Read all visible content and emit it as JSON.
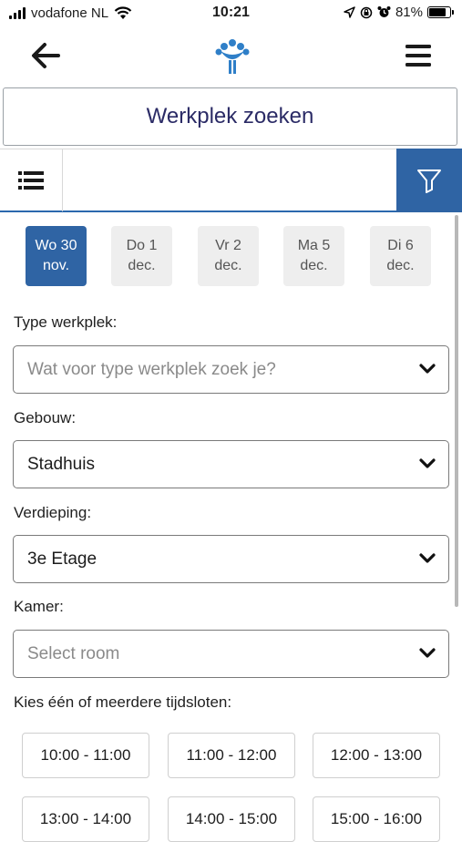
{
  "status_bar": {
    "carrier": "vodafone NL",
    "time": "10:21",
    "battery": "81%",
    "battery_level": 0.81,
    "icons": [
      "signal-icon",
      "wifi-icon",
      "location-icon",
      "orientation-lock-icon",
      "alarm-icon",
      "battery-icon"
    ]
  },
  "header": {
    "back_icon": "arrow-left-icon",
    "logo_icon": "organization-logo-icon",
    "menu_icon": "hamburger-menu-icon"
  },
  "page_title": "Werkplek zoeken",
  "search": {
    "value": "",
    "placeholder": "",
    "list_icon": "list-view-icon",
    "filter_icon": "filter-icon",
    "accent": "#2f64a4"
  },
  "dates": [
    {
      "day": "Wo 30",
      "month": "nov.",
      "selected": true
    },
    {
      "day": "Do 1",
      "month": "dec.",
      "selected": false
    },
    {
      "day": "Vr 2",
      "month": "dec.",
      "selected": false
    },
    {
      "day": "Ma 5",
      "month": "dec.",
      "selected": false
    },
    {
      "day": "Di 6",
      "month": "dec.",
      "selected": false
    }
  ],
  "fields": {
    "type": {
      "label": "Type werkplek:",
      "placeholder": "Wat voor type werkplek zoek je?",
      "value": ""
    },
    "building": {
      "label": "Gebouw:",
      "value": "Stadhuis"
    },
    "floor": {
      "label": "Verdieping:",
      "value": "3e Etage"
    },
    "room": {
      "label": "Kamer:",
      "placeholder": "Select room",
      "value": ""
    }
  },
  "timeslots": {
    "label": "Kies één of meerdere tijdsloten:",
    "slots": [
      "10:00 - 11:00",
      "11:00 - 12:00",
      "12:00 - 13:00",
      "13:00 - 14:00",
      "14:00 - 15:00",
      "15:00 - 16:00"
    ]
  }
}
